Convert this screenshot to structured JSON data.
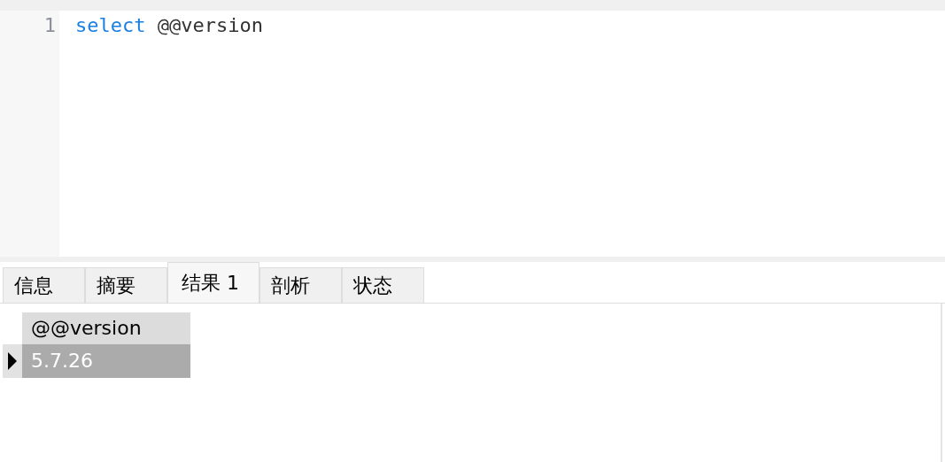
{
  "editor": {
    "lines": [
      {
        "number": "1",
        "tokens": [
          {
            "text": "select",
            "kind": "keyword"
          },
          {
            "text": " @@version",
            "kind": "plain"
          }
        ]
      }
    ]
  },
  "tabs": [
    {
      "label": "信息",
      "selected": false
    },
    {
      "label": "摘要",
      "selected": false
    },
    {
      "label": "结果 1",
      "selected": true
    },
    {
      "label": "剖析",
      "selected": false
    },
    {
      "label": "状态",
      "selected": false
    }
  ],
  "result_grid": {
    "columns": [
      "@@version"
    ],
    "rows": [
      {
        "cells": [
          "5.7.26"
        ],
        "selected": true
      }
    ]
  }
}
